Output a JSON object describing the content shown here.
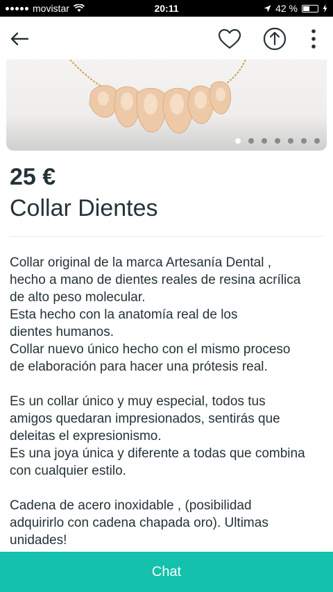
{
  "status_bar": {
    "carrier": "movistar",
    "time": "20:11",
    "battery": "42 %",
    "battery_level": 0.42
  },
  "header": {
    "back_icon": "arrow-left-icon",
    "favorite_icon": "heart-icon",
    "share_icon": "share-icon",
    "more_icon": "more-vertical-icon"
  },
  "gallery": {
    "image_count": 7,
    "active_index": 0
  },
  "product": {
    "price": "25 €",
    "title": "Collar Dientes",
    "description": "Collar original de la marca Artesanía Dental ,\nhecho a mano de dientes reales de resina acrílica\nde alto peso molecular.\nEsta hecho con la anatomía real de los\ndientes humanos.\nCollar nuevo único hecho con el mismo proceso\nde elaboración para hacer una prótesis real.\n\nEs un collar único y muy especial, todos tus\namigos quedaran impresionados, sentirás que\ndeleitas el expresionismo.\nEs una joya única y diferente a todas que combina\ncon cualquier estilo.\n\nCadena de acero inoxidable , (posibilidad\nadquirirlo con cadena chapada oro). Ultimas\nunidades!"
  },
  "chat_button": {
    "label": "Chat",
    "color": "#13c1ac"
  }
}
